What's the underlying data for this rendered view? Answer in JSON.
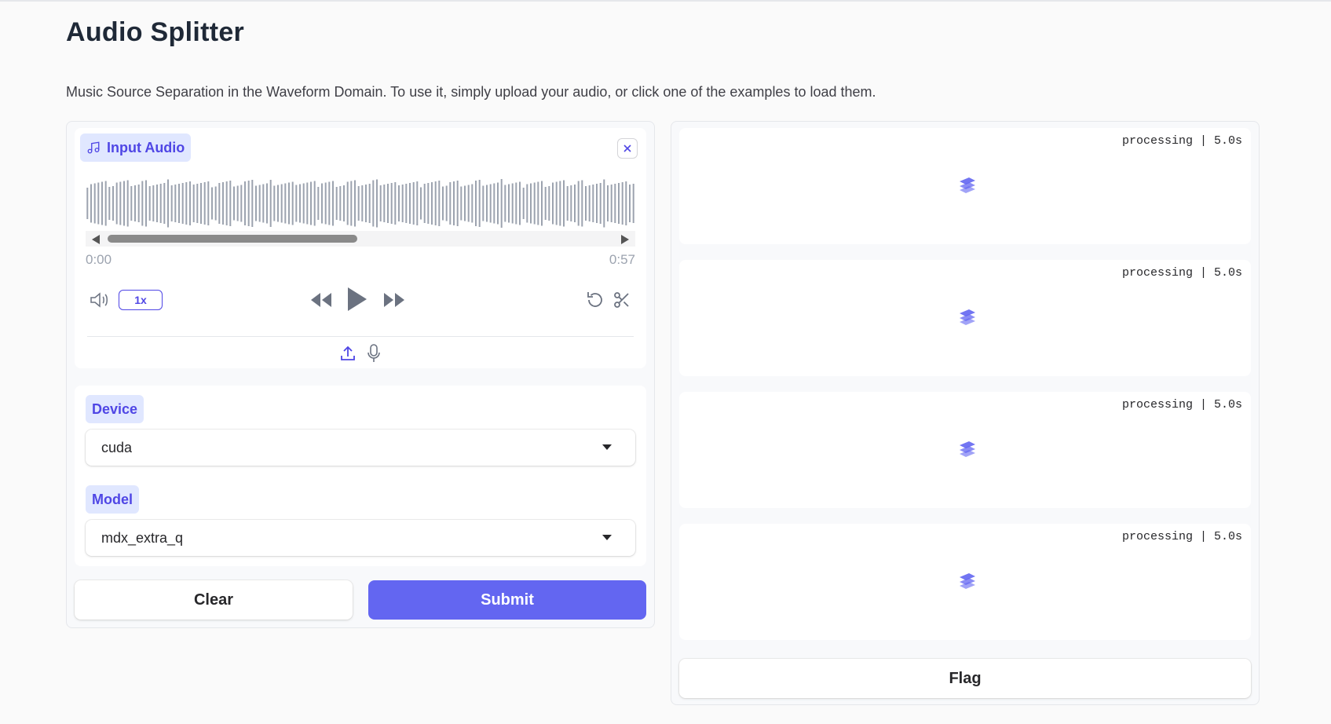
{
  "app": {
    "title": "Audio Splitter",
    "description": "Music Source Separation in the Waveform Domain. To use it, simply upload your audio, or click one of the examples to load them."
  },
  "input_audio": {
    "label": "Input Audio",
    "time_start": "0:00",
    "time_end": "0:57",
    "playback_speed": "1x",
    "icons": [
      "music-note-icon",
      "close-icon",
      "volume-icon",
      "rewind-icon",
      "play-icon",
      "fast-forward-icon",
      "reset-icon",
      "scissors-icon",
      "upload-icon",
      "microphone-icon"
    ]
  },
  "device": {
    "label": "Device",
    "value": "cuda"
  },
  "model": {
    "label": "Model",
    "value": "mdx_extra_q"
  },
  "actions": {
    "clear_label": "Clear",
    "submit_label": "Submit",
    "flag_label": "Flag"
  },
  "outputs": [
    {
      "status": "processing | 5.0s"
    },
    {
      "status": "processing | 5.0s"
    },
    {
      "status": "processing | 5.0s"
    },
    {
      "status": "processing | 5.0s"
    }
  ],
  "colors": {
    "accent": "#6366f1",
    "label_bg": "#e0e7ff",
    "label_text": "#4f46e5"
  }
}
